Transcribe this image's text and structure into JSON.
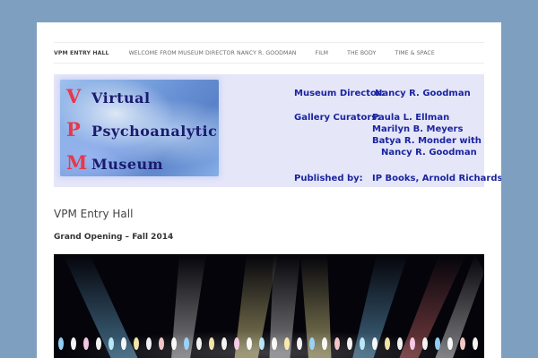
{
  "nav": {
    "items": [
      {
        "label": "VPM ENTRY HALL",
        "current": true
      },
      {
        "label": "WELCOME FROM MUSEUM DIRECTOR NANCY R. GOODMAN",
        "current": false
      },
      {
        "label": "FILM",
        "current": false
      },
      {
        "label": "THE BODY",
        "current": false
      },
      {
        "label": "TIME & SPACE",
        "current": false
      }
    ]
  },
  "banner": {
    "logo": {
      "lines": [
        {
          "initial": "V",
          "word": "Virtual"
        },
        {
          "initial": "P",
          "word": "Psychoanalytic"
        },
        {
          "initial": "M",
          "word": "Museum"
        }
      ],
      "initial_color": "#e8384a",
      "word_color": "#1a1a6e"
    },
    "director_label": "Museum Director:",
    "director_value": "Nancy R. Goodman",
    "curators_label": "Gallery Curators:",
    "curators": [
      "Paula L. Ellman",
      "Marilyn B. Meyers",
      "Batya R. Monder with",
      "Nancy R. Goodman"
    ],
    "published_label": "Published by:",
    "published_value": "IP Books, Arnold Richards",
    "text_color": "#1a24a0",
    "background": "#e5e6f8"
  },
  "entry": {
    "title": "VPM Entry Hall",
    "subtitle": "Grand Opening – Fall 2014"
  },
  "colors": {
    "page_background": "#7f9fc0",
    "content_background": "#ffffff"
  }
}
